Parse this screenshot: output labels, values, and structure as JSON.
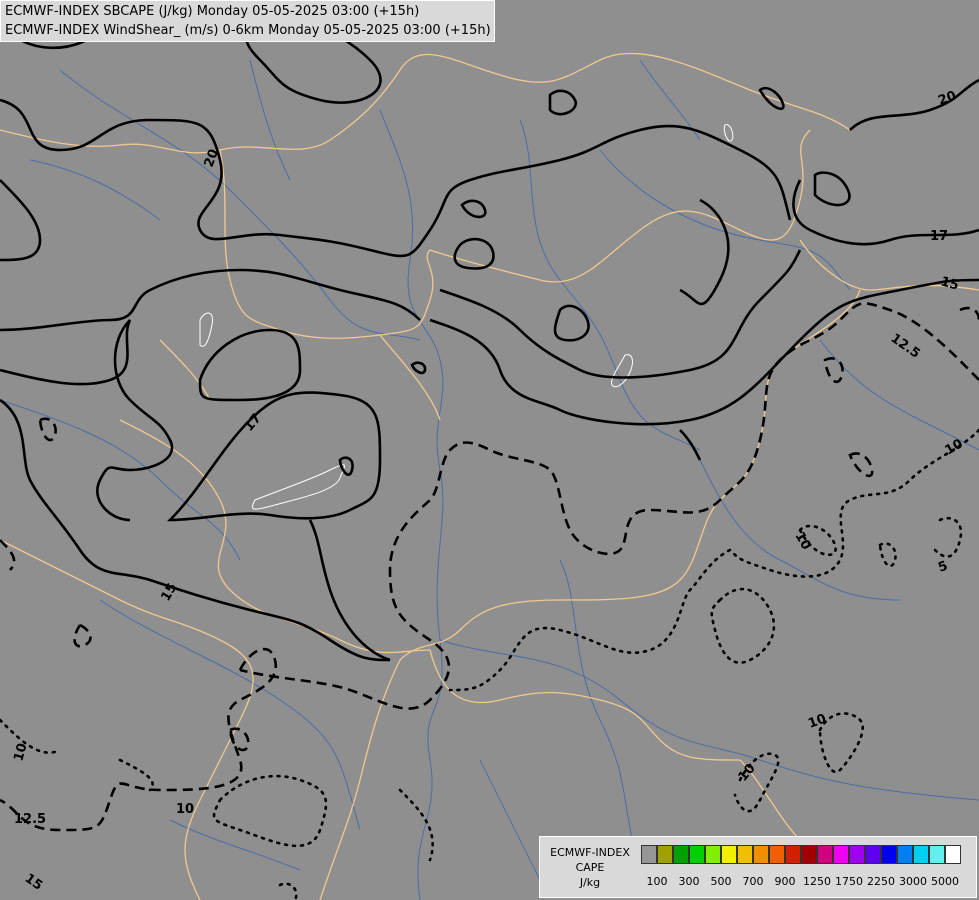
{
  "header": {
    "line1": "ECMWF-INDEX SBCAPE (J/kg) Monday 05-05-2025 03:00 (+15h)",
    "line2": "ECMWF-INDEX WindShear_ (m/s) 0-6km Monday 05-05-2025 03:00 (+15h)"
  },
  "legend": {
    "line1": "ECMWF-INDEX",
    "line2": "CAPE",
    "line3": "J/kg",
    "colors": [
      "#969696",
      "#a0a000",
      "#00a000",
      "#00d000",
      "#80f000",
      "#f0f000",
      "#f0c000",
      "#f09000",
      "#f06000",
      "#d02000",
      "#a00000",
      "#d00080",
      "#f000f0",
      "#a000f0",
      "#6000f0",
      "#0000f0",
      "#0080f0",
      "#00d0f0",
      "#60f0f0",
      "#ffffff"
    ],
    "ticks": [
      "100",
      "300",
      "500",
      "700",
      "900",
      "1250",
      "1750",
      "2250",
      "3000",
      "5000"
    ]
  },
  "contour_labels": {
    "l20a": "20",
    "l20b": "20",
    "l17a": "17",
    "l17b": "17",
    "l15a": "15",
    "l15b": "15",
    "l15c": "15",
    "l125a": "12.5",
    "l125b": "12.5",
    "l10a": "10",
    "l10b": "10",
    "l10c": "10",
    "l10d": "10",
    "l10e": "10",
    "l10f": "10",
    "l5": "5"
  },
  "colors": {
    "land": "#8f8f8f",
    "border": "#f0c890",
    "river": "#4a6ea8",
    "contour": "#000000"
  }
}
